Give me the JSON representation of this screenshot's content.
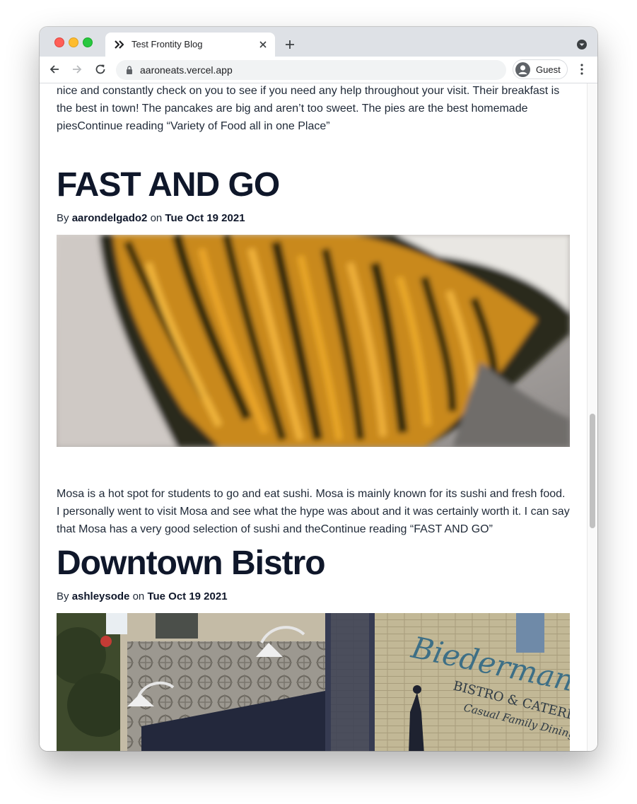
{
  "browser": {
    "tab_title": "Test Frontity Blog",
    "url": "aaroneats.vercel.app",
    "profile_label": "Guest"
  },
  "posts": [
    {
      "excerpt_partial": "nice and constantly check on you to see if you need any help throughout your visit. Their breakfast is the best in town! The pancakes are big and aren’t too sweet. The pies are the best homemade piesContinue reading “Variety of Food all in one Place”"
    },
    {
      "title": "FAST AND GO",
      "by_label": "By",
      "author": "aarondelgado2",
      "on_label": "on",
      "date": "Tue Oct 19 2021",
      "image_alt": "close-up of sushi roll",
      "excerpt": "Mosa is a hot spot for students to go and eat sushi. Mosa is mainly known for its sushi and fresh food. I personally went to visit Mosa and see what the hype was about and it was certainly worth it. I can say that Mosa has a very good selection of sushi and theContinue reading “FAST AND GO”"
    },
    {
      "title": "Downtown Bistro",
      "by_label": "By",
      "author": "ashleysode",
      "on_label": "on",
      "date": "Tue Oct 19 2021",
      "image_alt": "Biederman's Bistro & Catering storefront",
      "sign_lines": [
        "Biederman's",
        "BISTRO & CATERING",
        "Casual Family Dining"
      ]
    }
  ],
  "colors": {
    "heading": "#0f172a",
    "text": "#1f2937",
    "chrome_bg": "#dee1e6"
  }
}
